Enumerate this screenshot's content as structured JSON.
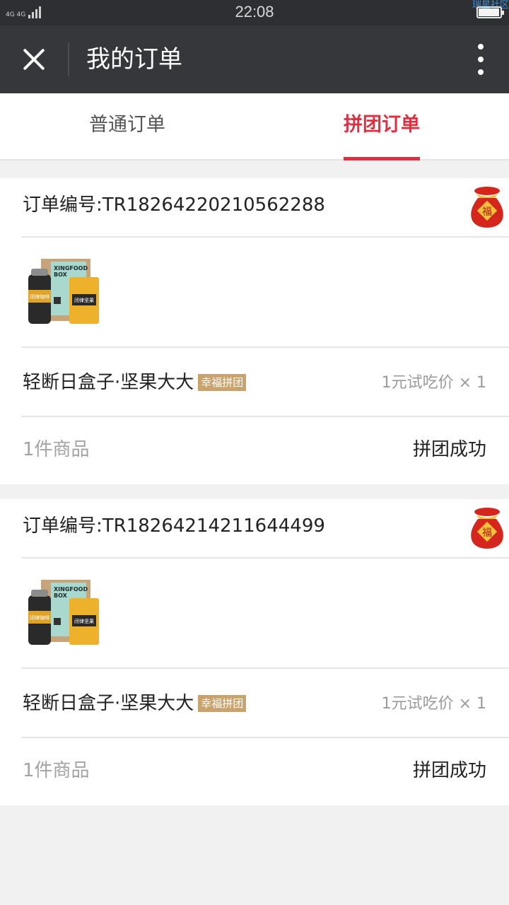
{
  "status_bar": {
    "network": "4G 4G",
    "time": "22:08",
    "watermark": "瑞星社区",
    "battery_level": 0.95
  },
  "navbar": {
    "title": "我的订单",
    "close_icon": "close-icon",
    "more_icon": "more-vertical-icon"
  },
  "tabs": [
    {
      "label": "普通订单",
      "active": false
    },
    {
      "label": "拼团订单",
      "active": true
    }
  ],
  "orders": [
    {
      "order_label": "订单编号:",
      "order_no": "TR18264220210562288",
      "product_name": "轻断日盒子·坚果大大",
      "tag": "幸福拼团",
      "price": "1元试吃价 × 1",
      "item_count": "1件商品",
      "status": "拼团成功"
    },
    {
      "order_label": "订单编号:",
      "order_no": "TR18264214211644499",
      "product_name": "轻断日盒子·坚果大大",
      "tag": "幸福拼团",
      "price": "1元试吃价 × 1",
      "item_count": "1件商品",
      "status": "拼团成功"
    }
  ],
  "product_image": {
    "box_line1": "XINGFOOD",
    "box_line2": "BOX",
    "bottle_label": "闭律咖啡",
    "pouch_label": "闭律坚果"
  },
  "colors": {
    "accent": "#e02e3f",
    "navbar": "#35373b",
    "tag": "#c9a36b"
  }
}
